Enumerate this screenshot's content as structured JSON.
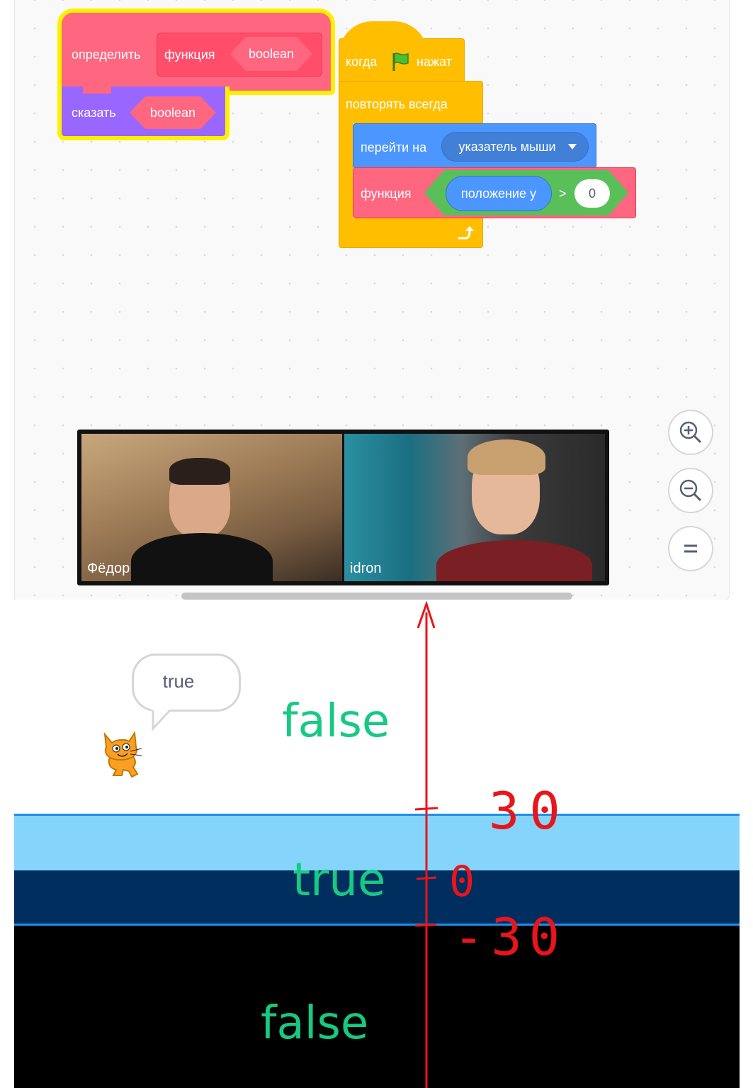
{
  "blocks": {
    "define": {
      "keyword": "определить",
      "name": "функция",
      "param": "boolean"
    },
    "say": {
      "label": "сказать",
      "param": "boolean"
    },
    "hat": {
      "when": "когда",
      "clicked": "нажат",
      "flag_icon": "green-flag-icon"
    },
    "forever": {
      "label": "повторять всегда",
      "loop_icon": "loop-arrow-icon"
    },
    "goto": {
      "label": "перейти на",
      "target": "указатель мыши"
    },
    "call": {
      "name": "функция",
      "reporter": "положение y",
      "operator": ">",
      "value": "0"
    }
  },
  "zoom": {
    "in_icon": "zoom-in-icon",
    "out_icon": "zoom-out-icon",
    "reset_icon": "zoom-reset-icon"
  },
  "video": {
    "participants": [
      {
        "name": "Фёдор"
      },
      {
        "name": "idron"
      }
    ]
  },
  "stage": {
    "speech": "true",
    "sprite_icon": "scratch-cat-icon",
    "zones": [
      {
        "label": "false",
        "color": "#ffffff"
      },
      {
        "label": "true",
        "color": "#85d4fc"
      },
      {
        "label": "false",
        "color": "#000000"
      }
    ],
    "annotations": {
      "top": "30",
      "middle": "0",
      "bottom": "-30"
    }
  },
  "colors": {
    "custom_block": "#ff6680",
    "looks_block": "#9966ff",
    "events_block": "#ffbf00",
    "motion_block": "#4c97ff",
    "operator_block": "#59c059",
    "highlight": "#fff000",
    "stage_text": "#17c983",
    "annotation": "#e8151b"
  }
}
